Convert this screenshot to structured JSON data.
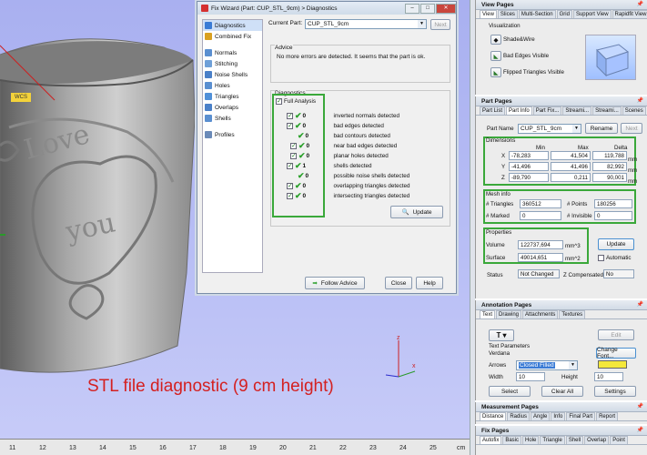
{
  "viewport": {
    "caption": "STL file diagnostic (9 cm height)",
    "wcs_label": "WCS",
    "ruler_ticks": [
      "11",
      "12",
      "13",
      "14",
      "15",
      "16",
      "17",
      "18",
      "19",
      "20",
      "21",
      "22",
      "23",
      "24",
      "25"
    ],
    "ruler_unit": "cm",
    "axis_z": "z",
    "axis_x": "x",
    "cup_texts": {
      "love": "Love",
      "you": "you"
    }
  },
  "wizard": {
    "title": "Fix Wizard (Part: CUP_STL_9cm) > Diagnostics",
    "sidebar": [
      "Diagnostics",
      "Combined Fix",
      "Normals",
      "Stitching",
      "Noise Shells",
      "Holes",
      "Triangles",
      "Overlaps",
      "Shells",
      "Profiles"
    ],
    "current_part_label": "Current Part:",
    "current_part_value": "CUP_STL_9cm",
    "next_label": "Next",
    "advice_label": "Advice",
    "advice_text": "No more errors are detected. It seems that the part is ok.",
    "diagnostics_label": "Diagnostics",
    "full_analysis_label": "Full Analysis",
    "rows": [
      {
        "num": "0",
        "text": "inverted normals detected"
      },
      {
        "num": "0",
        "text": "bad edges detected"
      },
      {
        "num": "0",
        "text": "bad contours detected"
      },
      {
        "num": "0",
        "text": "near bad edges detected"
      },
      {
        "num": "0",
        "text": "planar holes detected"
      },
      {
        "num": "1",
        "text": "shells detected"
      },
      {
        "num": "0",
        "text": "possible noise shells detected"
      },
      {
        "num": "0",
        "text": "overlapping triangles detected"
      },
      {
        "num": "0",
        "text": "intersecting triangles detected"
      }
    ],
    "update_label": "Update",
    "follow_advice_label": "Follow Advice",
    "close_label": "Close",
    "help_label": "Help"
  },
  "view_pages": {
    "title": "View Pages",
    "tabs": [
      "View",
      "Slices",
      "Multi-Section",
      "Grid",
      "Support View",
      "Rapidfit View"
    ],
    "visualization_label": "Visualization",
    "items": [
      "Shade&Wire",
      "Bad Edges Visible",
      "Flipped Triangles Visible"
    ]
  },
  "part_pages": {
    "title": "Part Pages",
    "tabs": [
      "Part List",
      "Part Info",
      "Part Fix...",
      "Streami...",
      "Streami...",
      "Scenes"
    ],
    "part_name_label": "Part Name",
    "part_name_value": "CUP_STL_9cm",
    "rename_label": "Rename",
    "next_label": "Next",
    "dimensions_label": "Dimensions",
    "dim_headers": [
      "Min",
      "Max",
      "Delta"
    ],
    "dims": [
      {
        "axis": "X",
        "min": "-78,283",
        "max": "41,504",
        "delta": "119,788",
        "unit": "mm"
      },
      {
        "axis": "Y",
        "min": "-41,496",
        "max": "41,496",
        "delta": "82,992",
        "unit": "mm"
      },
      {
        "axis": "Z",
        "min": "-89,790",
        "max": "0,211",
        "delta": "90,001",
        "unit": "mm"
      }
    ],
    "mesh_label": "Mesh info",
    "triangles_label": "# Triangles",
    "triangles_value": "360512",
    "points_label": "# Points",
    "points_value": "180256",
    "marked_label": "# Marked",
    "marked_value": "0",
    "invisible_label": "# Invisible",
    "invisible_value": "0",
    "properties_label": "Properties",
    "volume_label": "Volume",
    "volume_value": "122737,694",
    "volume_unit": "mm^3",
    "surface_label": "Surface",
    "surface_value": "49014,651",
    "surface_unit": "mm^2",
    "update_label": "Update",
    "automatic_label": "Automatic",
    "status_label": "Status",
    "status_value": "Not Changed",
    "z_comp_label": "Z Compensated",
    "z_comp_value": "No"
  },
  "annotation_pages": {
    "title": "Annotation Pages",
    "tabs": [
      "Text",
      "Drawing",
      "Attachments",
      "Textures"
    ],
    "edit_label": "Edit",
    "text_params_label": "Text Parameters",
    "font_name": "Verdana",
    "change_font_label": "Change Font...",
    "arrows_label": "Arrows",
    "arrows_value": "Closed Filled",
    "width_label": "Width",
    "width_value": "10",
    "height_label": "Height",
    "height_value": "10",
    "select_label": "Select",
    "clear_all_label": "Clear All",
    "settings_label": "Settings",
    "swatch_color": "#f5e83a"
  },
  "measurement_pages": {
    "title": "Measurement Pages",
    "tabs": [
      "Distance",
      "Radius",
      "Angle",
      "Info",
      "Final Part",
      "Report"
    ]
  },
  "fix_pages": {
    "title": "Fix Pages",
    "tabs": [
      "Autofix",
      "Basic",
      "Hole",
      "Triangle",
      "Shell",
      "Overlap",
      "Point"
    ]
  }
}
